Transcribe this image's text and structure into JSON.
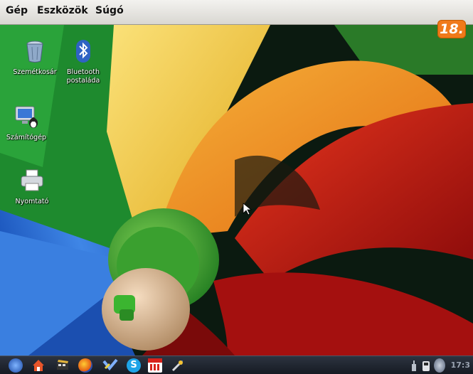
{
  "menubar": {
    "items": [
      "Gép",
      "Eszközök",
      "Súgó"
    ]
  },
  "badge": "18.",
  "desktop_icons": [
    {
      "label": "Szemétkosár",
      "icon": "trash-icon"
    },
    {
      "label": "Bluetooth postaláda",
      "icon": "bluetooth-icon"
    },
    {
      "label": "Számítógép",
      "icon": "computer-icon"
    },
    {
      "label": "Nyomtató",
      "icon": "printer-icon"
    }
  ],
  "taskbar": {
    "icons": [
      "start-menu-icon",
      "home-icon",
      "film-icon",
      "firefox-icon",
      "mail-icon",
      "skype-icon",
      "calendar-icon",
      "tools-icon"
    ],
    "tray": [
      "network-icon",
      "usb-icon",
      "update-icon"
    ],
    "clock": "17:3"
  },
  "colors": {
    "menubar": "#e8e6e1",
    "taskbar": "#1f2530",
    "badge": "#f07a1a"
  }
}
